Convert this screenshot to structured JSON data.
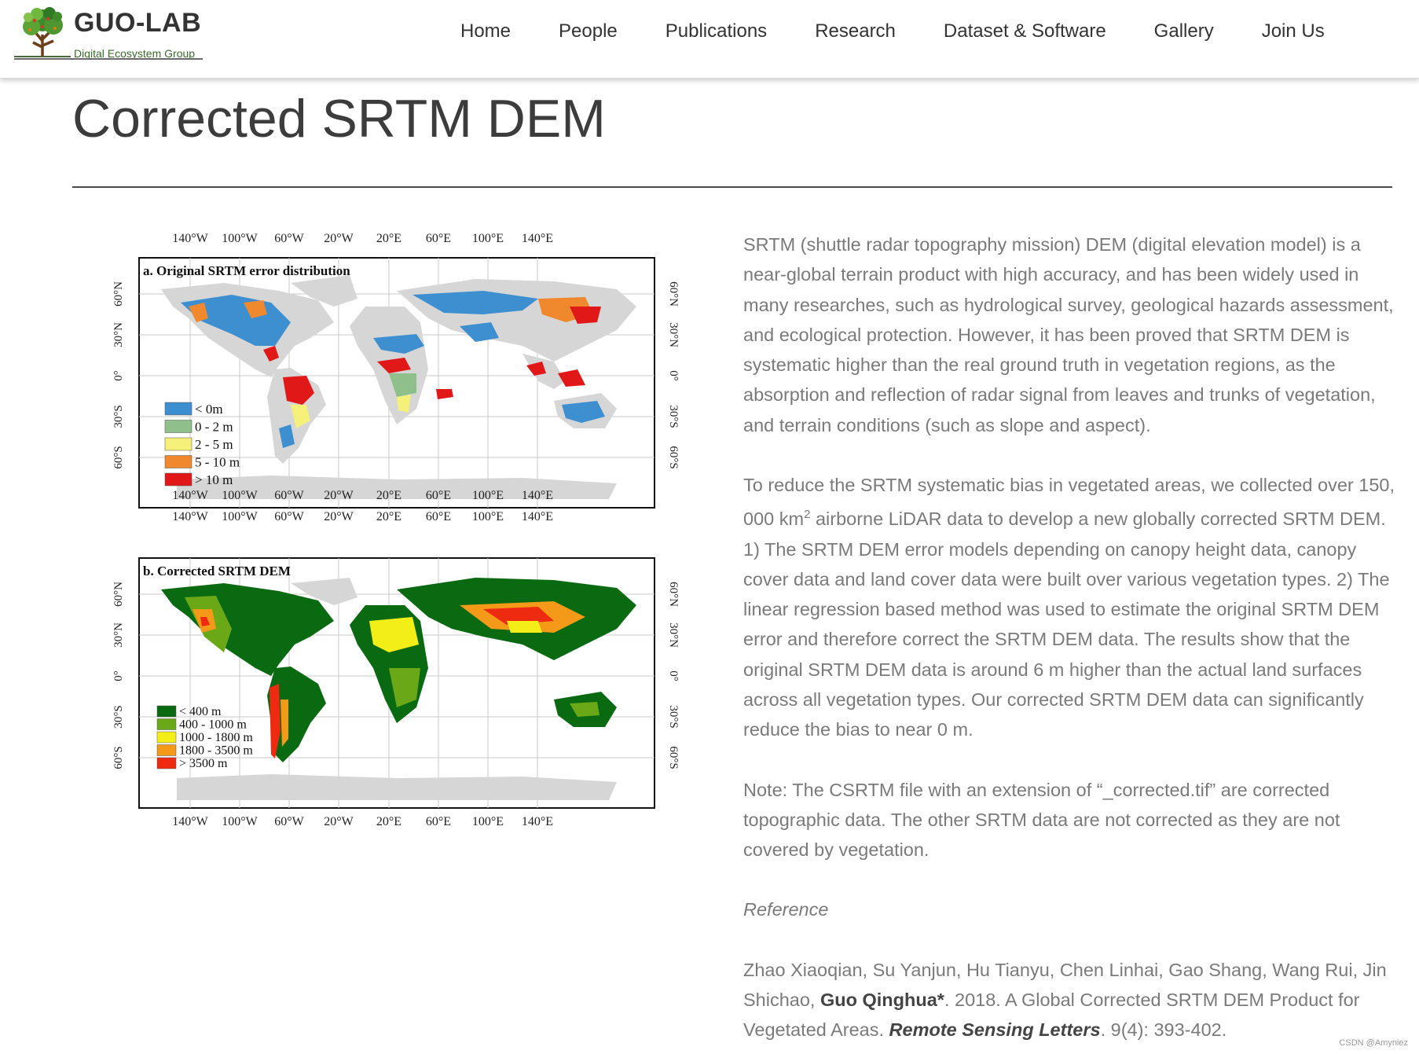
{
  "brand": {
    "name": "GUO-LAB",
    "tagline": "Digital Ecosystem Group"
  },
  "nav": {
    "items": [
      "Home",
      "People",
      "Publications",
      "Research",
      "Dataset & Software",
      "Gallery",
      "Join Us"
    ]
  },
  "page": {
    "title": "Corrected SRTM DEM"
  },
  "figure": {
    "lon_labels": [
      "140°W",
      "100°W",
      "60°W",
      "20°W",
      "20°E",
      "60°E",
      "100°E",
      "140°E"
    ],
    "lat_labels": [
      "60°N",
      "30°N",
      "0°",
      "30°S",
      "60°S"
    ],
    "panel_a": {
      "title": "a. Original SRTM error distribution",
      "legend": [
        {
          "label": "< 0m",
          "color": "#3d8fd0"
        },
        {
          "label": "0 - 2 m",
          "color": "#8fbf8a"
        },
        {
          "label": "2 - 5 m",
          "color": "#f5f07a"
        },
        {
          "label": "5 - 10 m",
          "color": "#f0892e"
        },
        {
          "label": "> 10 m",
          "color": "#e01818"
        }
      ]
    },
    "panel_b": {
      "title": "b. Corrected SRTM DEM",
      "legend": [
        {
          "label": "< 400 m",
          "color": "#0a6a12"
        },
        {
          "label": "400 - 1000 m",
          "color": "#6aa818"
        },
        {
          "label": "1000 - 1800 m",
          "color": "#f4ee18"
        },
        {
          "label": "1800 - 3500 m",
          "color": "#f59a18"
        },
        {
          "label": "> 3500 m",
          "color": "#ee2a10"
        }
      ]
    }
  },
  "content": {
    "para1": "SRTM (shuttle radar topography mission) DEM (digital elevation model) is a near-global terrain product with high accuracy, and has been widely used in many researches, such as hydrological survey, geological hazards assessment, and ecological protection. However, it has been proved that SRTM DEM is systematic higher than the real ground truth in vegetation regions, as the absorption and reflection of radar signal from leaves and trunks of vegetation, and terrain conditions (such as slope and aspect).",
    "para2_pre": "To reduce the SRTM systematic bias in vegetated areas, we collected over 150, 000 km",
    "para2_sup": "2",
    "para2_post": " airborne LiDAR data to develop a new globally corrected SRTM DEM. 1) The SRTM DEM error models depending on canopy height data, canopy cover data and land cover data were built over various vegetation types. 2) The linear regression based method was used to estimate the original SRTM DEM error and therefore correct the SRTM DEM data. The results show that the original SRTM DEM data is around 6 m higher than the actual land surfaces across all vegetation types. Our corrected SRTM DEM data can significantly reduce the bias to near 0 m.",
    "para3": "Note: The CSRTM file with an extension of “_corrected.tif” are corrected topographic data. The other SRTM data are not corrected as they are not covered by vegetation.",
    "ref_heading": "Reference",
    "ref_authors": "Zhao Xiaoqian, Su Yanjun, Hu Tianyu, Chen Linhai, Gao Shang, Wang Rui, Jin Shichao, ",
    "ref_lead": "Guo Qinghua*",
    "ref_mid": ". 2018. A Global Corrected SRTM DEM Product for Vegetated Areas. ",
    "ref_journal": "Remote Sensing Letters",
    "ref_tail": ". 9(4): 393-402."
  },
  "watermark": "CSDN @Amyniez"
}
